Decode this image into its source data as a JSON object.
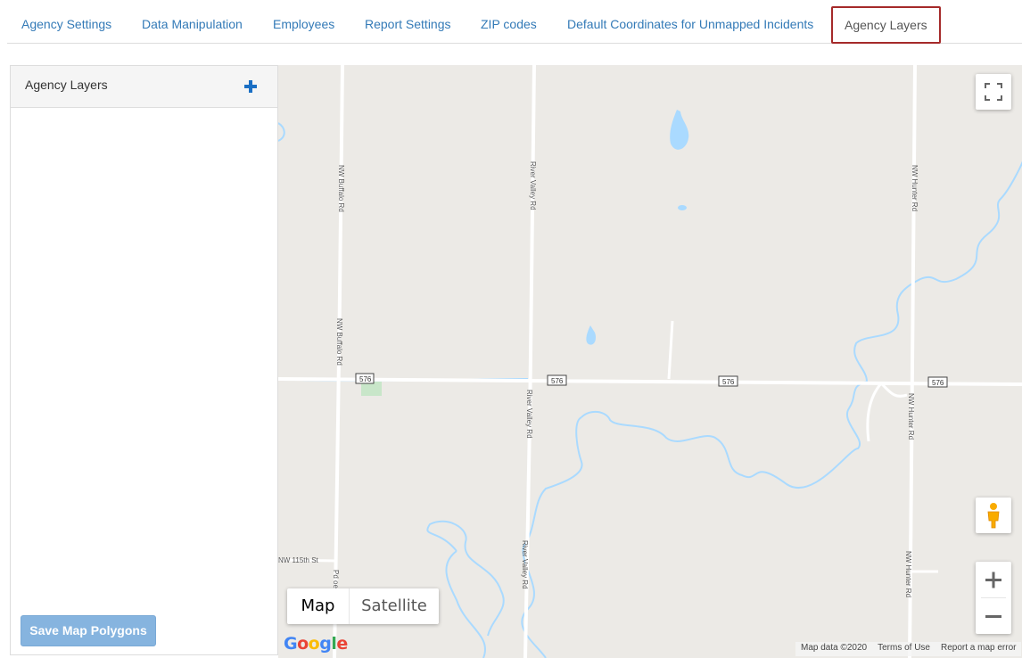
{
  "tabs": [
    {
      "label": "Agency Settings"
    },
    {
      "label": "Data Manipulation"
    },
    {
      "label": "Employees"
    },
    {
      "label": "Report Settings"
    },
    {
      "label": "ZIP codes"
    },
    {
      "label": "Default Coordinates for Unmapped Incidents"
    },
    {
      "label": "Agency Layers",
      "active": true
    }
  ],
  "panel": {
    "title": "Agency Layers",
    "add_icon": "plus-icon",
    "save_label": "Save Map Polygons"
  },
  "map": {
    "roads": {
      "buffalo_upper": "NW Buffalo Rd",
      "buffalo_lower": "NW Buffalo Rd",
      "river_valley_upper": "River Valley Rd",
      "river_valley_mid": "River Valley Rd",
      "river_valley_lower": "River Valley Rd",
      "hunter_upper": "NW Hunter Rd",
      "hunter_mid": "NW Hunter Rd",
      "hunter_lower": "NW Hunter Rd",
      "street_115": "NW 115th St",
      "buffalo_bottom": "Pd oe"
    },
    "highway_shield": "576",
    "type_map": "Map",
    "type_satellite": "Satellite",
    "logo": "Google",
    "attribution": {
      "data": "Map data ©2020",
      "terms": "Terms of Use",
      "report": "Report a map error"
    },
    "controls": {
      "fullscreen_icon": "fullscreen-icon",
      "pegman_icon": "pegman-icon",
      "zoom_in_icon": "zoom-in-icon",
      "zoom_out_icon": "zoom-out-icon"
    },
    "colors": {
      "land": "#eceae6",
      "water": "#aadaff",
      "road": "#ffffff",
      "park": "#c8e6c9",
      "accent": "#a52a2a",
      "link": "#337ab7"
    }
  }
}
